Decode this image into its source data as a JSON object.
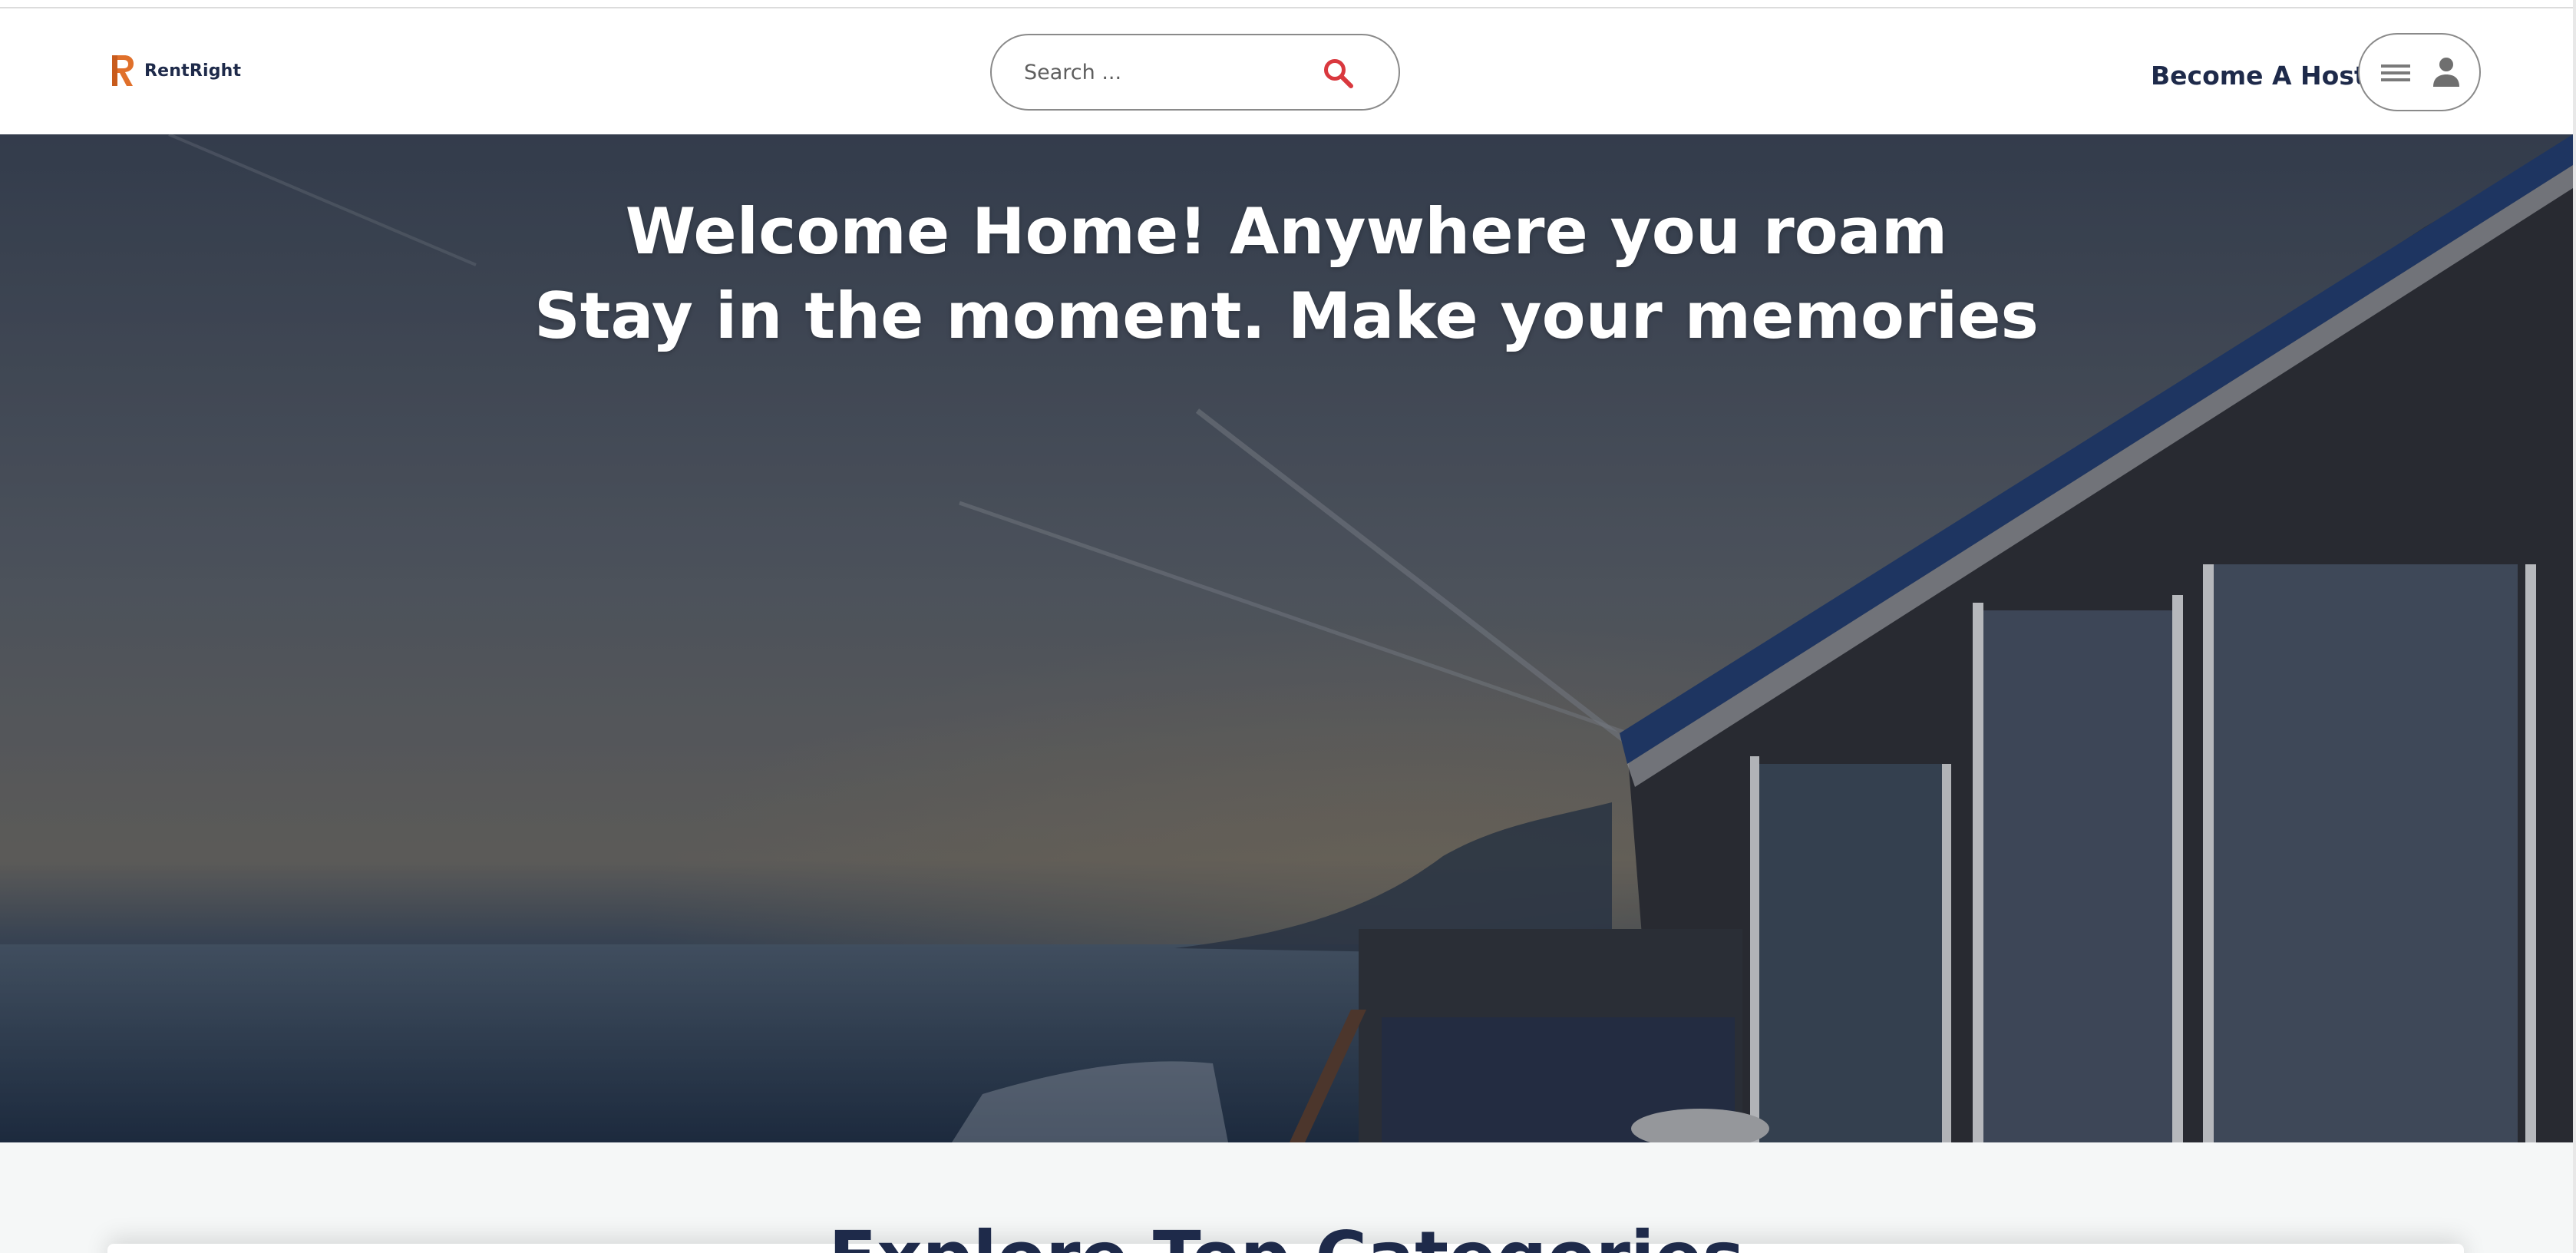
{
  "header": {
    "logo_text": "RentRight",
    "search": {
      "placeholder": "Search ..."
    },
    "become_host_label": "Become A Host"
  },
  "hero": {
    "line1": "Welcome Home! Anywhere you roam",
    "line2": "Stay in the moment. Make your memories"
  },
  "categories": {
    "title": "Explore Top Categories"
  },
  "colors": {
    "brand_orange": "#e0702b",
    "navy_text": "#1e2a4a",
    "search_icon": "#d9383e",
    "hero_text": "#ffffff"
  },
  "icons": {
    "search": "search-icon",
    "menu": "hamburger-menu-icon",
    "user": "person-icon"
  }
}
